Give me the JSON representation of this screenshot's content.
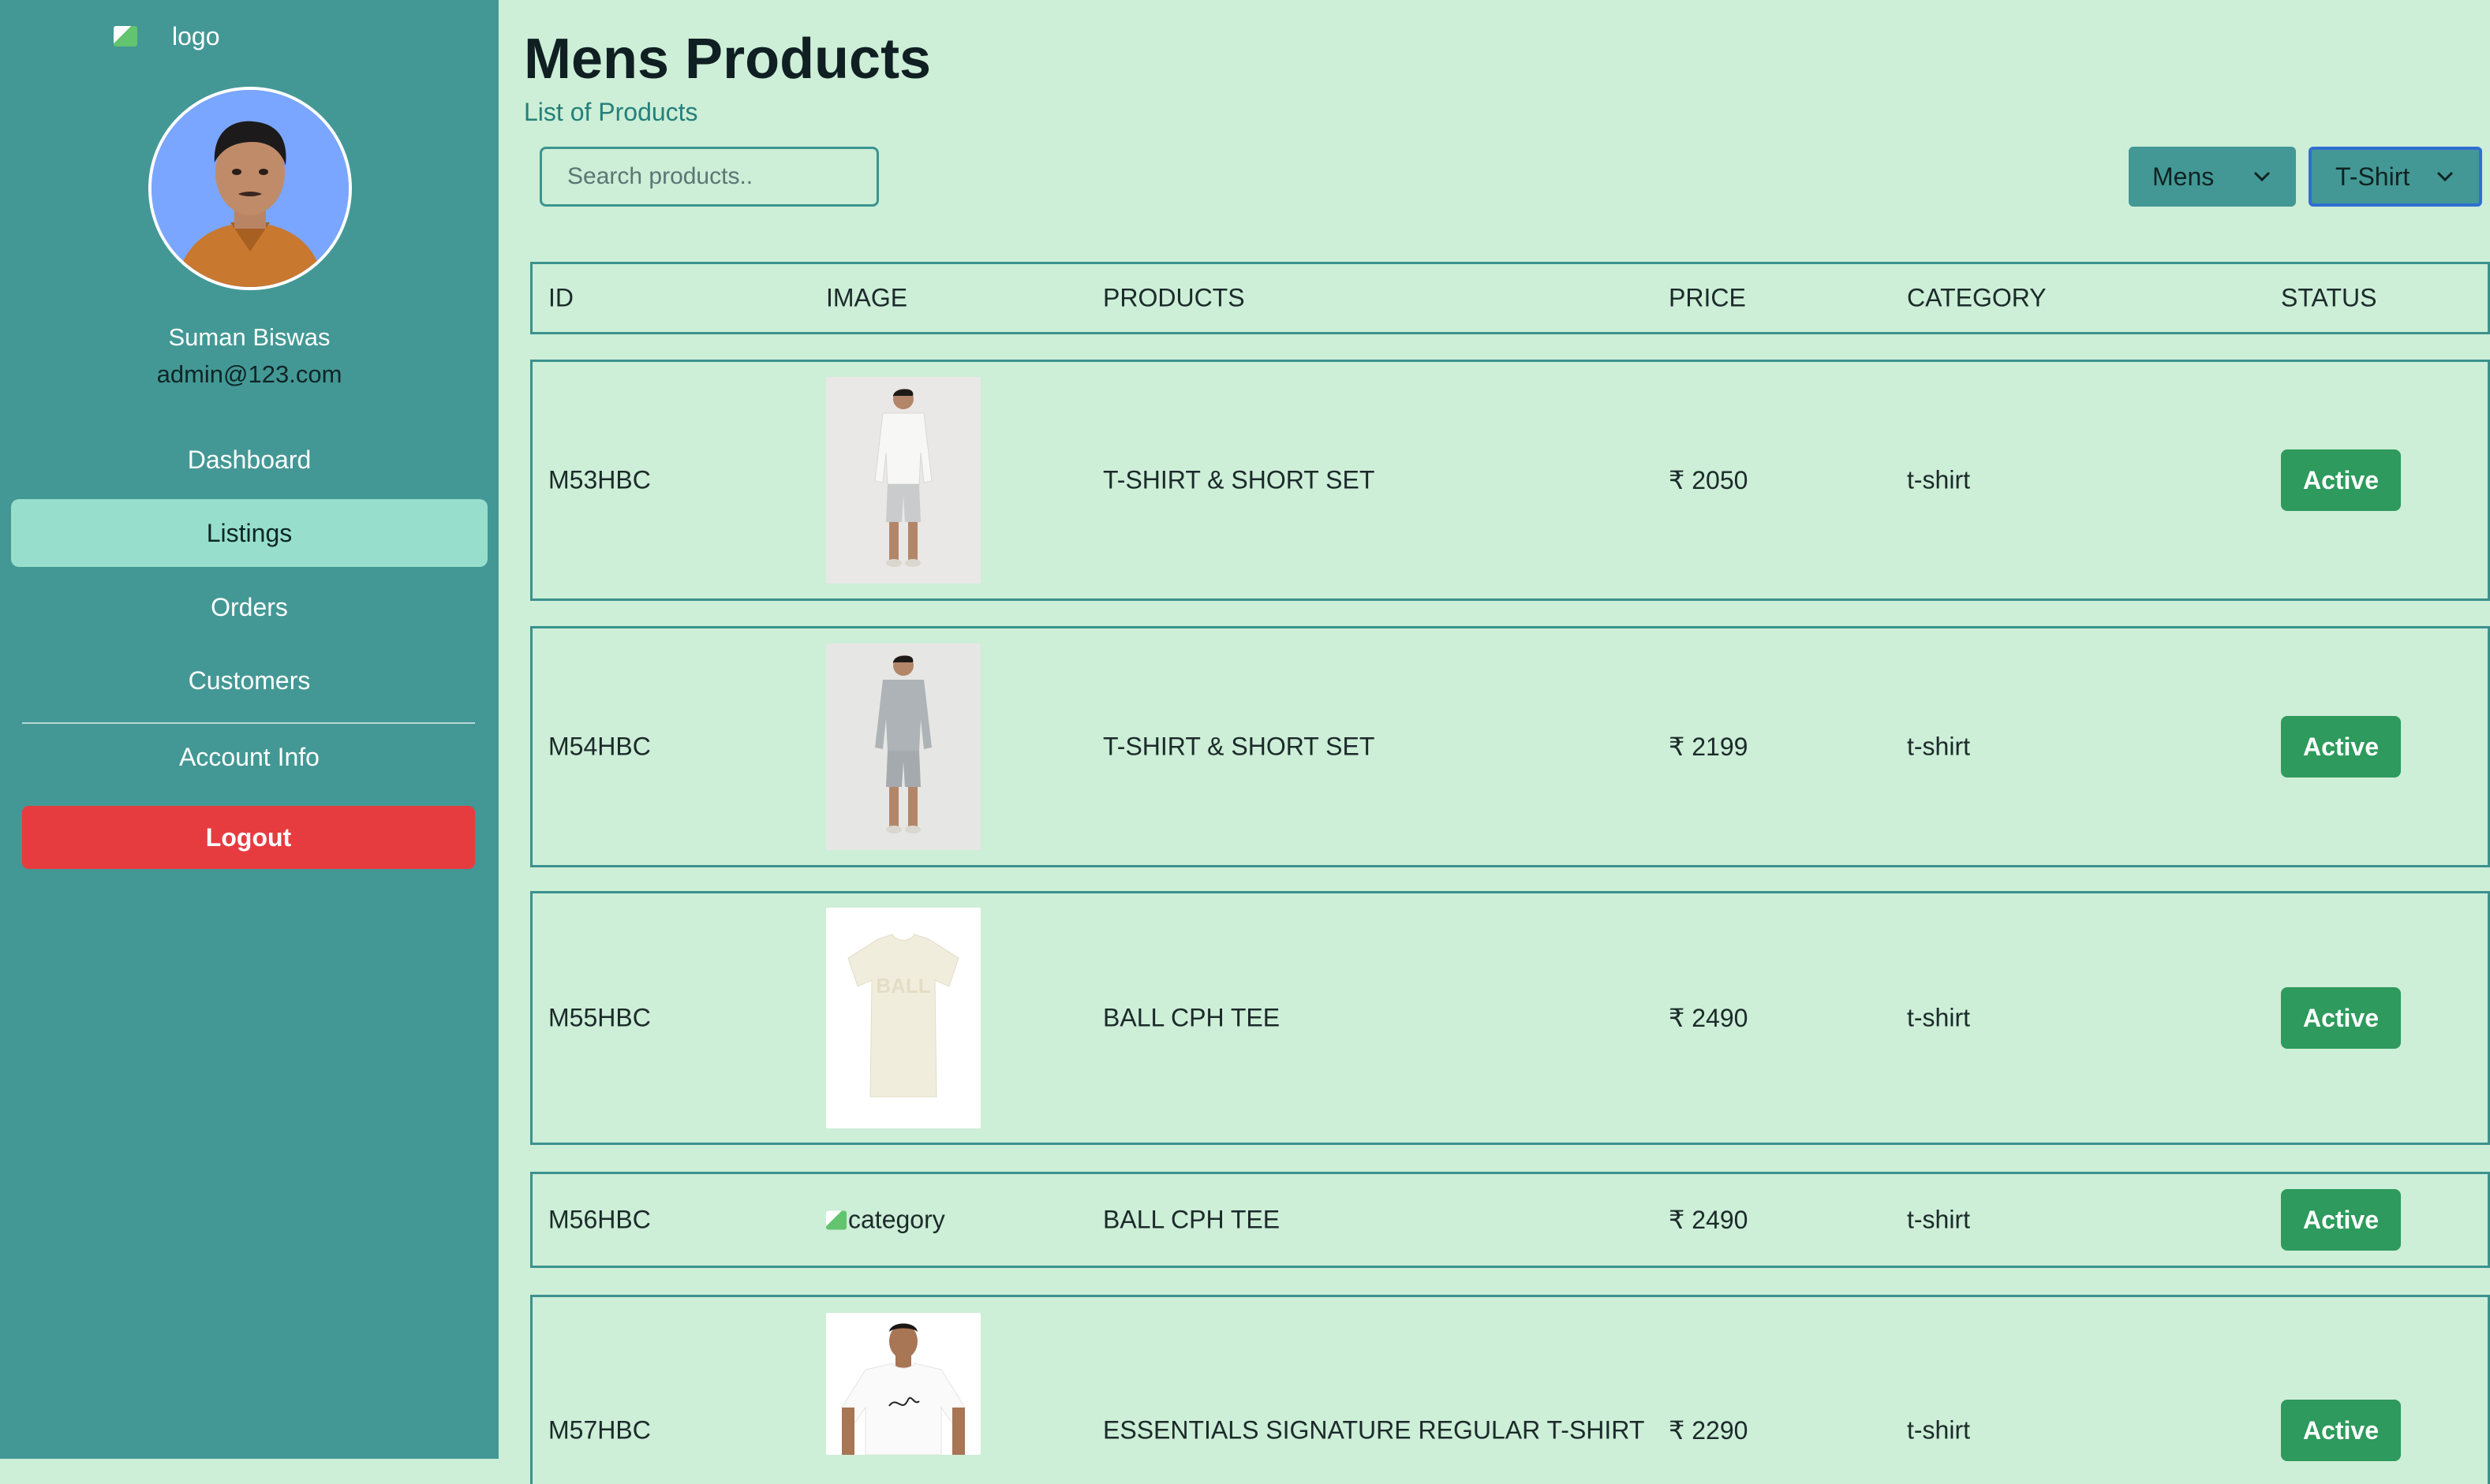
{
  "sidebar": {
    "logo_alt": "logo",
    "profile": {
      "name": "Suman Biswas",
      "email": "admin@123.com"
    },
    "nav": [
      {
        "label": "Dashboard",
        "active": false
      },
      {
        "label": "Listings",
        "active": true
      },
      {
        "label": "Orders",
        "active": false
      },
      {
        "label": "Customers",
        "active": false
      },
      {
        "label": "Account Info",
        "active": false
      }
    ],
    "logout_label": "Logout"
  },
  "header": {
    "title": "Mens Products",
    "subtitle": "List of Products"
  },
  "search": {
    "placeholder": "Search products.."
  },
  "filters": {
    "gender": "Mens",
    "category": "T-Shirt"
  },
  "table": {
    "columns": [
      "ID",
      "IMAGE",
      "PRODUCTS",
      "PRICE",
      "CATEGORY",
      "STATUS"
    ],
    "rows": [
      {
        "id": "M53HBC",
        "image": "white-tee-short-set",
        "product": "T-SHIRT & SHORT SET",
        "price": "₹ 2050",
        "category": "t-shirt",
        "status": "Active"
      },
      {
        "id": "M54HBC",
        "image": "grey-tee-short-set",
        "product": "T-SHIRT & SHORT SET",
        "price": "₹ 2199",
        "category": "t-shirt",
        "status": "Active"
      },
      {
        "id": "M55HBC",
        "image": "cream-ball-tee",
        "product": "BALL CPH TEE",
        "price": "₹ 2490",
        "category": "t-shirt",
        "status": "Active"
      },
      {
        "id": "M56HBC",
        "image_alt": "category",
        "product": "BALL CPH TEE",
        "price": "₹ 2490",
        "category": "t-shirt",
        "status": "Active"
      },
      {
        "id": "M57HBC",
        "image": "white-signature-tee",
        "product": "ESSENTIALS SIGNATURE REGULAR T-SHIRT",
        "price": "₹ 2290",
        "category": "t-shirt",
        "status": "Active"
      }
    ]
  },
  "colors": {
    "sidebar_bg": "#439895",
    "page_bg": "#cdeed7",
    "active_nav": "#97dfcc",
    "logout": "#e63c40",
    "status_active": "#2e9a5d",
    "border": "#3a928e"
  }
}
